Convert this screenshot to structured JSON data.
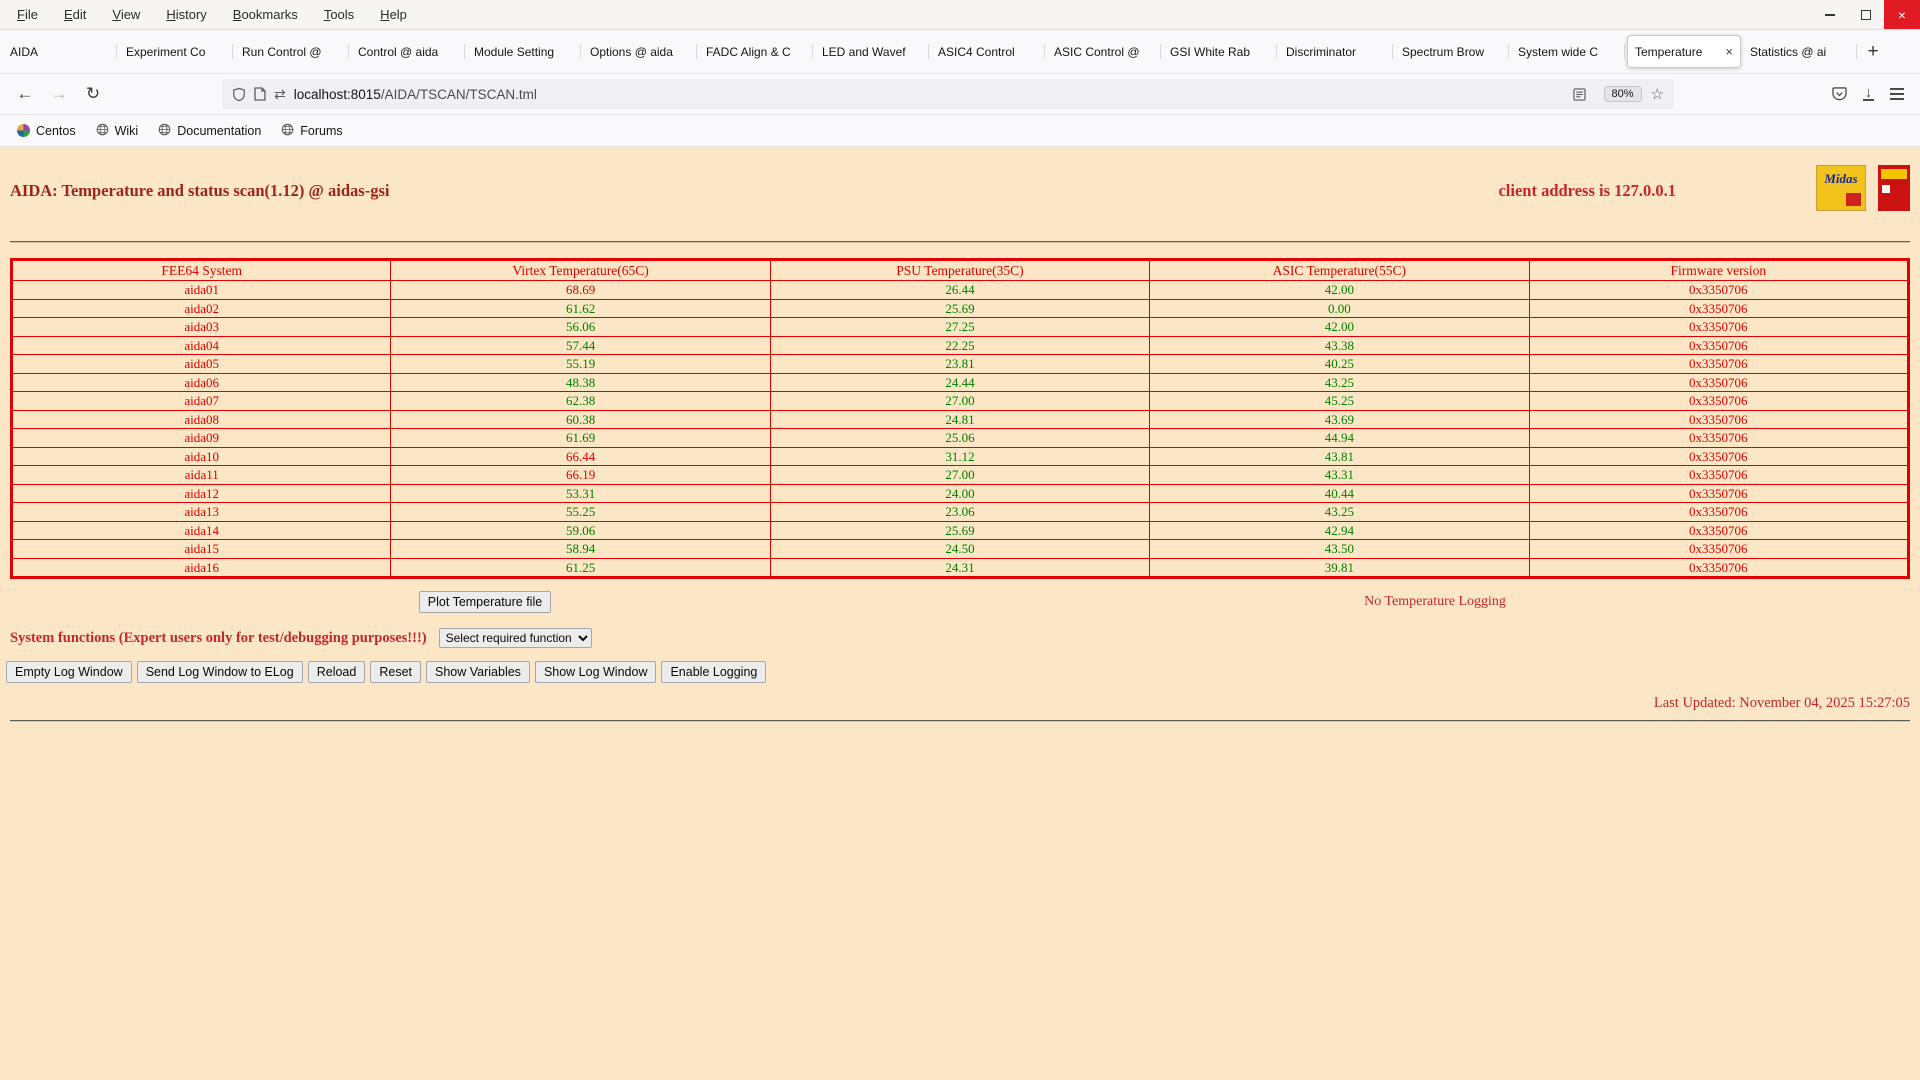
{
  "colors": {
    "page_bg": "#fbe7c5",
    "table_border": "#e00000",
    "red": "#c3272b",
    "dark_red": "#9c241b",
    "green": "#008000"
  },
  "browser": {
    "menus": [
      "File",
      "Edit",
      "View",
      "History",
      "Bookmarks",
      "Tools",
      "Help"
    ],
    "window_controls": {
      "close_glyph": "×"
    },
    "tabs": [
      {
        "label": "AIDA"
      },
      {
        "label": "Experiment Co"
      },
      {
        "label": "Run Control @"
      },
      {
        "label": "Control @ aida"
      },
      {
        "label": "Module Setting"
      },
      {
        "label": "Options @ aida"
      },
      {
        "label": "FADC Align & C"
      },
      {
        "label": "LED and Wavef"
      },
      {
        "label": "ASIC4 Control"
      },
      {
        "label": "ASIC Control @"
      },
      {
        "label": "GSI White Rab"
      },
      {
        "label": "Discriminator"
      },
      {
        "label": "Spectrum Brow"
      },
      {
        "label": "System wide C"
      },
      {
        "label": "Temperature",
        "active": true
      },
      {
        "label": "Statistics @ ai"
      }
    ],
    "new_tab_label": "+",
    "nav": {
      "back": "←",
      "forward": "→",
      "reload": "↻",
      "arrows_icon": "⇄",
      "url_host": "localhost:8015",
      "url_path": "/AIDA/TSCAN/TSCAN.tml",
      "zoom_badge": "80%",
      "star": "☆"
    },
    "bookmarks": [
      "Centos",
      "Wiki",
      "Documentation",
      "Forums"
    ]
  },
  "page": {
    "title": "AIDA: Temperature and status scan(1.12) @ aidas-gsi",
    "client_address": "client address is 127.0.0.1",
    "logos": {
      "midas": "Midas"
    },
    "table": {
      "headers": [
        "FEE64 System",
        "Virtex Temperature(65C)",
        "PSU Temperature(35C)",
        "ASIC Temperature(55C)",
        "Firmware version"
      ],
      "rows": [
        {
          "name": "aida01",
          "virtex": "68.69",
          "virtex_alarm": true,
          "psu": "26.44",
          "asic": "42.00",
          "firmware": "0x3350706"
        },
        {
          "name": "aida02",
          "virtex": "61.62",
          "virtex_alarm": false,
          "psu": "25.69",
          "asic": "0.00",
          "firmware": "0x3350706"
        },
        {
          "name": "aida03",
          "virtex": "56.06",
          "virtex_alarm": false,
          "psu": "27.25",
          "asic": "42.00",
          "firmware": "0x3350706"
        },
        {
          "name": "aida04",
          "virtex": "57.44",
          "virtex_alarm": false,
          "psu": "22.25",
          "asic": "43.38",
          "firmware": "0x3350706"
        },
        {
          "name": "aida05",
          "virtex": "55.19",
          "virtex_alarm": false,
          "psu": "23.81",
          "asic": "40.25",
          "firmware": "0x3350706"
        },
        {
          "name": "aida06",
          "virtex": "48.38",
          "virtex_alarm": false,
          "psu": "24.44",
          "asic": "43.25",
          "firmware": "0x3350706"
        },
        {
          "name": "aida07",
          "virtex": "62.38",
          "virtex_alarm": false,
          "psu": "27.00",
          "asic": "45.25",
          "firmware": "0x3350706"
        },
        {
          "name": "aida08",
          "virtex": "60.38",
          "virtex_alarm": false,
          "psu": "24.81",
          "asic": "43.69",
          "firmware": "0x3350706"
        },
        {
          "name": "aida09",
          "virtex": "61.69",
          "virtex_alarm": false,
          "psu": "25.06",
          "asic": "44.94",
          "firmware": "0x3350706"
        },
        {
          "name": "aida10",
          "virtex": "66.44",
          "virtex_alarm": true,
          "psu": "31.12",
          "asic": "43.81",
          "firmware": "0x3350706"
        },
        {
          "name": "aida11",
          "virtex": "66.19",
          "virtex_alarm": true,
          "psu": "27.00",
          "asic": "43.31",
          "firmware": "0x3350706"
        },
        {
          "name": "aida12",
          "virtex": "53.31",
          "virtex_alarm": false,
          "psu": "24.00",
          "asic": "40.44",
          "firmware": "0x3350706"
        },
        {
          "name": "aida13",
          "virtex": "55.25",
          "virtex_alarm": false,
          "psu": "23.06",
          "asic": "43.25",
          "firmware": "0x3350706"
        },
        {
          "name": "aida14",
          "virtex": "59.06",
          "virtex_alarm": false,
          "psu": "25.69",
          "asic": "42.94",
          "firmware": "0x3350706"
        },
        {
          "name": "aida15",
          "virtex": "58.94",
          "virtex_alarm": false,
          "psu": "24.50",
          "asic": "43.50",
          "firmware": "0x3350706"
        },
        {
          "name": "aida16",
          "virtex": "61.25",
          "virtex_alarm": false,
          "psu": "24.31",
          "asic": "39.81",
          "firmware": "0x3350706"
        }
      ]
    },
    "plot_button": "Plot Temperature file",
    "logging_status": "No Temperature Logging",
    "system_functions_label": "System functions (Expert users only for test/debugging purposes!!!)",
    "function_select_value": "Select required function",
    "action_buttons": [
      "Empty Log Window",
      "Send Log Window to ELog",
      "Reload",
      "Reset",
      "Show Variables",
      "Show Log Window",
      "Enable Logging"
    ],
    "last_updated": "Last Updated: November 04, 2025 15:27:05"
  }
}
